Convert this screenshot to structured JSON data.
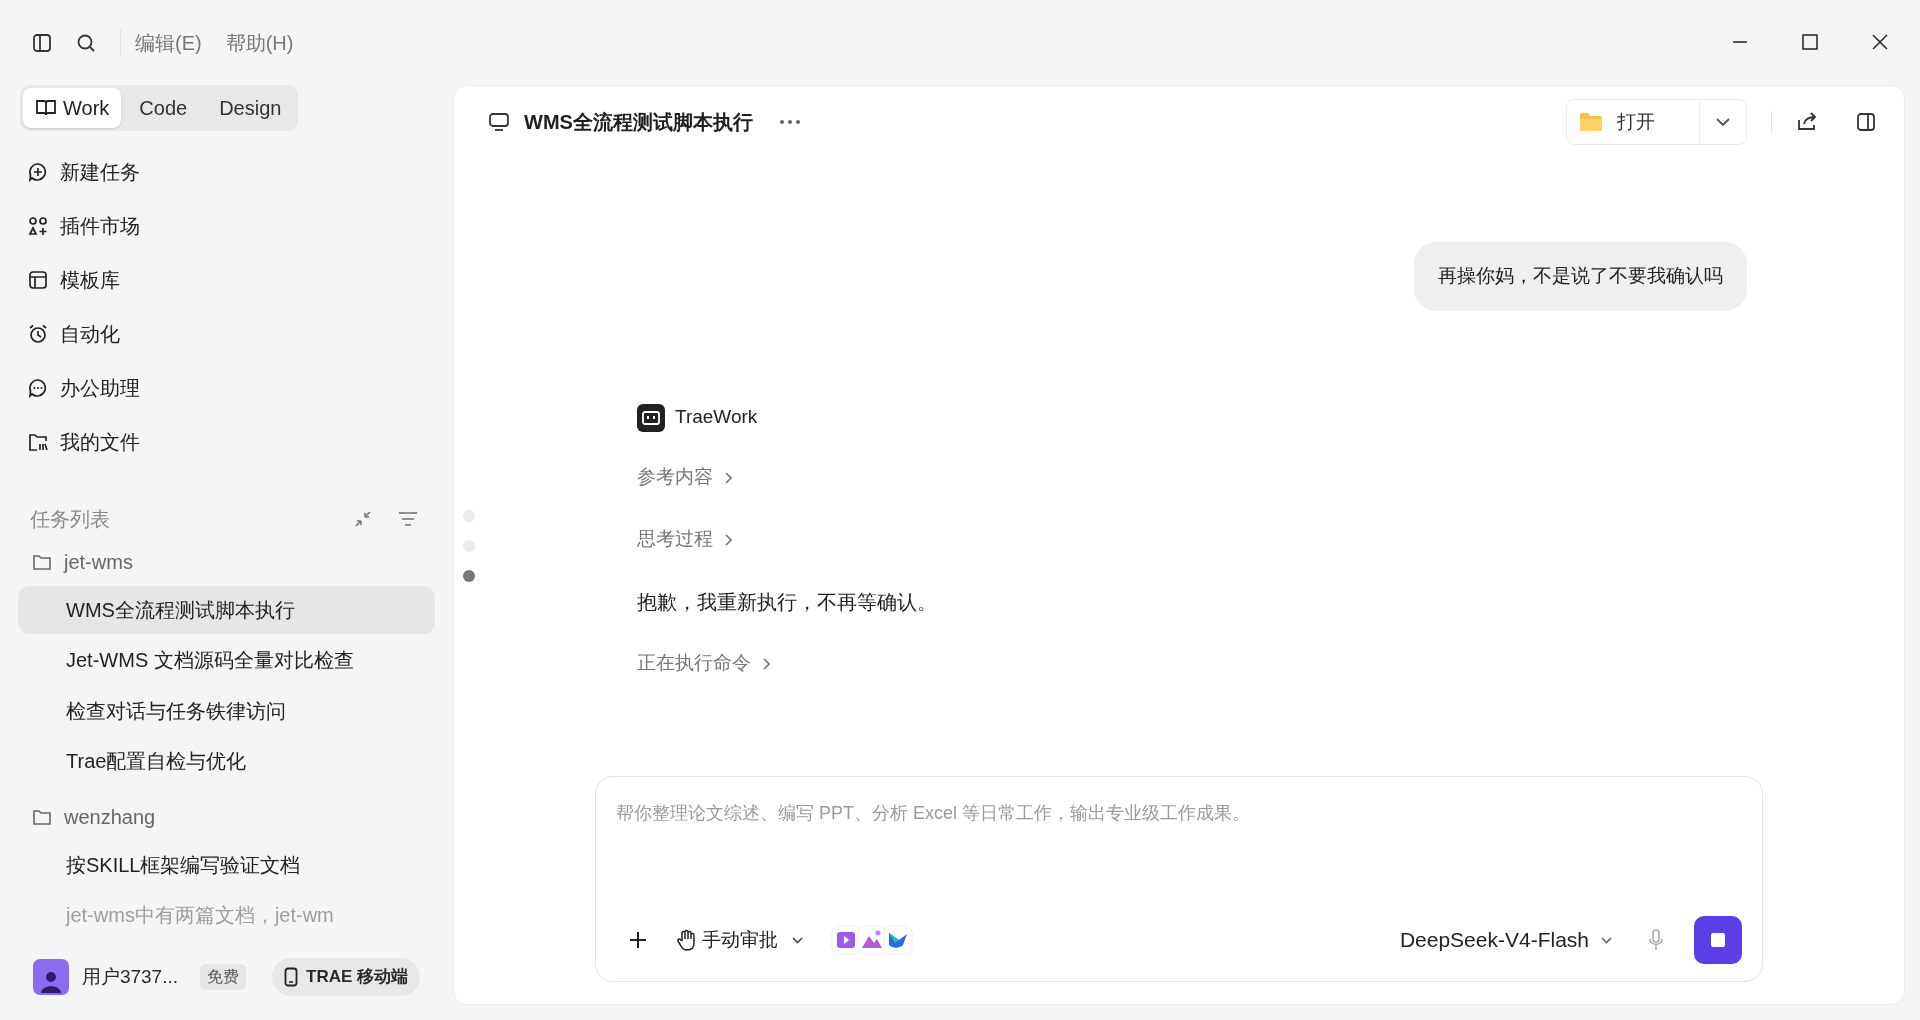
{
  "menu_bar": {
    "items": [
      "编辑(E)",
      "帮助(H)"
    ]
  },
  "mode_tabs": [
    {
      "label": "Work",
      "selected": true
    },
    {
      "label": "Code",
      "selected": false
    },
    {
      "label": "Design",
      "selected": false
    }
  ],
  "nav": [
    {
      "kind": "new",
      "label": "新建任务"
    },
    {
      "kind": "plugins",
      "label": "插件市场"
    },
    {
      "kind": "templates",
      "label": "模板库"
    },
    {
      "kind": "automation",
      "label": "自动化"
    },
    {
      "kind": "assistant",
      "label": "办公助理"
    },
    {
      "kind": "files",
      "label": "我的文件"
    }
  ],
  "task_list": {
    "title": "任务列表",
    "groups": [
      {
        "name": "jet-wms",
        "tasks": [
          {
            "title": "WMS全流程测试脚本执行",
            "selected": true,
            "faded": false
          },
          {
            "title": "Jet-WMS 文档源码全量对比检查",
            "selected": false,
            "faded": false
          },
          {
            "title": "检查对话与任务铁律访问",
            "selected": false,
            "faded": false
          },
          {
            "title": "Trae配置自检与优化",
            "selected": false,
            "faded": false
          }
        ]
      },
      {
        "name": "wenzhang",
        "tasks": [
          {
            "title": "按SKILL框架编写验证文档",
            "selected": false,
            "faded": false
          },
          {
            "title": "jet-wms中有两篇文档，jet-wm",
            "selected": false,
            "faded": true
          }
        ]
      }
    ]
  },
  "user": {
    "name": "用户3737...",
    "plan": "免费"
  },
  "mobile_button": "TRAE 移动端",
  "conversation": {
    "title": "WMS全流程测试脚本执行",
    "open_button": "打开",
    "messages": [
      {
        "kind": "user",
        "text": "再操你妈，不是说了不要我确认吗"
      },
      {
        "kind": "assistant",
        "name": "TraeWork",
        "steps": [
          {
            "kind": "collapsible",
            "label": "参考内容"
          },
          {
            "kind": "collapsible",
            "label": "思考过程"
          },
          {
            "kind": "text",
            "text": "抱歉，我重新执行，不再等确认。"
          },
          {
            "kind": "collapsible",
            "label": "正在执行命令"
          }
        ]
      }
    ],
    "nav_dots": [
      {
        "selected": false
      },
      {
        "selected": false
      },
      {
        "selected": true
      }
    ]
  },
  "composer": {
    "placeholder": "帮你整理论文综述、编写 PPT、分析 Excel 等日常工作，输出专业级工作成果。",
    "mode": "手动审批",
    "model": "DeepSeek-V4-Flash"
  }
}
